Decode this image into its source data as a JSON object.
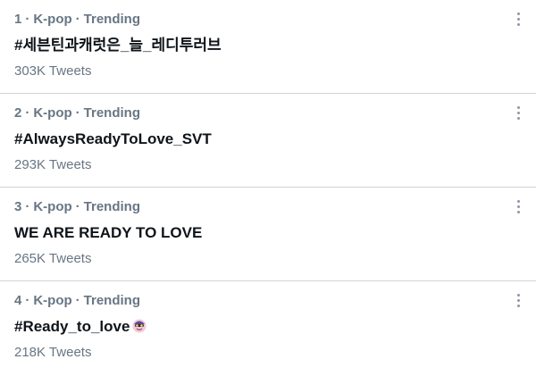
{
  "trends": [
    {
      "rank": "1",
      "category": "K-pop",
      "status": "Trending",
      "name": "#세븐틴과캐럿은_늘_레디투러브",
      "count": "303K Tweets",
      "icon": "more-vertical-icon"
    },
    {
      "rank": "2",
      "category": "K-pop",
      "status": "Trending",
      "name": "#AlwaysReadyToLove_SVT",
      "count": "293K Tweets",
      "icon": "more-vertical-icon"
    },
    {
      "rank": "3",
      "category": "K-pop",
      "status": "Trending",
      "name": "WE ARE READY TO LOVE",
      "count": "265K Tweets",
      "icon": "more-vertical-icon"
    },
    {
      "rank": "4",
      "category": "K-pop",
      "status": "Trending",
      "name": "#Ready_to_love",
      "count": "218K Tweets",
      "icon": "more-vertical-icon",
      "emoji": "seventeen-hashflag-icon"
    }
  ],
  "colors": {
    "meta_text": "#687684",
    "primary_text": "#0f1419",
    "divider": "#d0d4d8",
    "more_dots": "#8b98a5"
  }
}
